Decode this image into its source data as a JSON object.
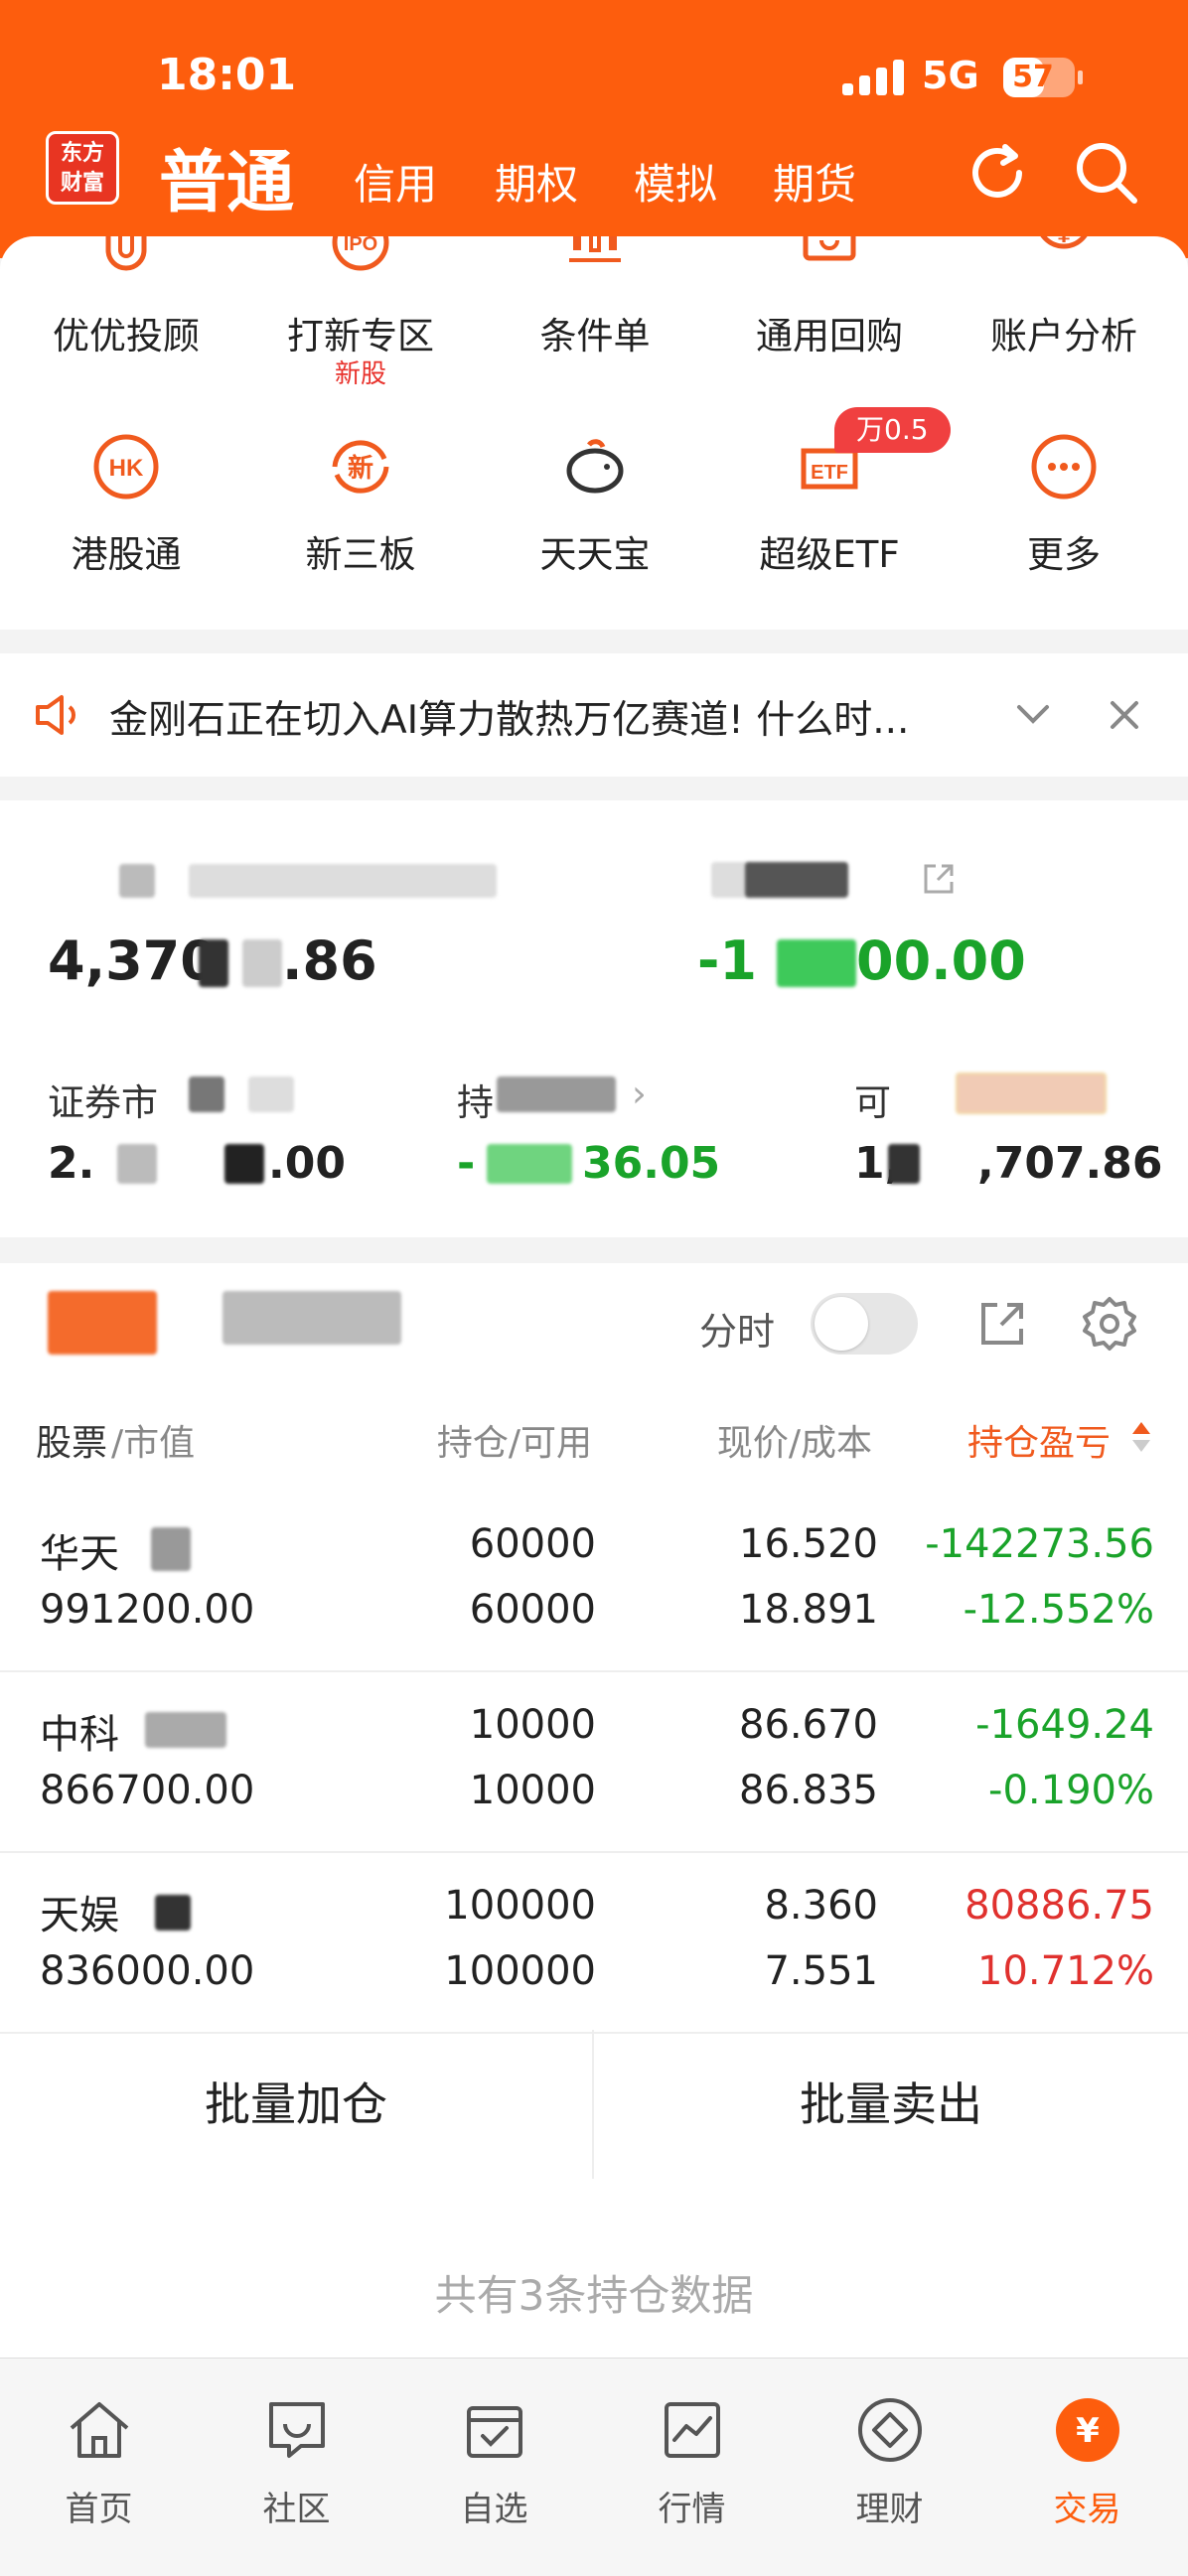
{
  "status_bar": {
    "time": "18:01",
    "network": "5G",
    "battery": "57",
    "battery_level": 0.57
  },
  "header": {
    "logo_line1": "东方",
    "logo_line2": "财富",
    "active_tab": "普通",
    "tabs": [
      "信用",
      "期权",
      "模拟",
      "期货"
    ],
    "brand_color": "#fd5d0d"
  },
  "grid": {
    "row1": [
      {
        "label": "优优投顾",
        "icon": "advisor-icon"
      },
      {
        "label": "打新专区",
        "sub": "新股",
        "icon": "ipo-icon"
      },
      {
        "label": "条件单",
        "icon": "condition-order-icon"
      },
      {
        "label": "通用回购",
        "icon": "repo-icon"
      },
      {
        "label": "账户分析",
        "icon": "account-analysis-icon"
      }
    ],
    "row2": [
      {
        "label": "港股通",
        "icon": "hk-icon"
      },
      {
        "label": "新三板",
        "icon": "neeq-icon"
      },
      {
        "label": "天天宝",
        "icon": "piggy-bank-icon"
      },
      {
        "label": "超级ETF",
        "icon": "etf-icon"
      },
      {
        "label": "更多",
        "icon": "more-icon"
      }
    ],
    "etf_badge": "万0.5",
    "row1_icon_glyphs": [
      "U",
      "IPO",
      "",
      "",
      "¥"
    ],
    "row2_icon_glyphs": [
      "HK",
      "新",
      "",
      "ETF",
      "⋯"
    ]
  },
  "notice": {
    "text": "金刚石正在切入AI算力散热万亿赛道! 什么时..."
  },
  "assets": {
    "total_assets_partial_a": "4,370",
    "total_assets_partial_b": ".86",
    "total_pl_partial_a": "-1",
    "total_pl_partial_b": "00.00",
    "market_value_label_partial": "证券市",
    "market_value_partial_a": "2.",
    "market_value_partial_b": ".00",
    "position_pl_label_partial": "持",
    "position_pl_partial_a": "-",
    "position_pl_partial_b": "36.05",
    "available_label_partial": "可",
    "available_partial_a": "1,",
    "available_partial_b": ",707.86"
  },
  "positions": {
    "toggle_label": "分时",
    "headers": {
      "stock": "股票",
      "market_value": "/市值",
      "holding": "持仓/可用",
      "price": "现价/成本",
      "pl": "持仓盈亏"
    },
    "rows": [
      {
        "name": "华天",
        "market_value": "991200.00",
        "holding": "60000",
        "available": "60000",
        "price": "16.520",
        "cost": "18.891",
        "pl": "-142273.56",
        "pl_pct": "-12.552%",
        "trend": "down"
      },
      {
        "name": "中科",
        "market_value": "866700.00",
        "holding": "10000",
        "available": "10000",
        "price": "86.670",
        "cost": "86.835",
        "pl": "-1649.24",
        "pl_pct": "-0.190%",
        "trend": "down"
      },
      {
        "name": "天娱",
        "market_value": "836000.00",
        "holding": "100000",
        "available": "100000",
        "price": "8.360",
        "cost": "7.551",
        "pl": "80886.75",
        "pl_pct": "10.712%",
        "trend": "up"
      }
    ],
    "batch_add": "批量加仓",
    "batch_sell": "批量卖出",
    "footer": "共有3条持仓数据"
  },
  "bottom_nav": [
    {
      "label": "首页",
      "icon": "home-icon"
    },
    {
      "label": "社区",
      "icon": "community-icon"
    },
    {
      "label": "自选",
      "icon": "watchlist-icon"
    },
    {
      "label": "行情",
      "icon": "market-icon"
    },
    {
      "label": "理财",
      "icon": "wealth-icon"
    },
    {
      "label": "交易",
      "icon": "trade-icon",
      "active": true
    }
  ],
  "trade_icon_glyph": "¥"
}
